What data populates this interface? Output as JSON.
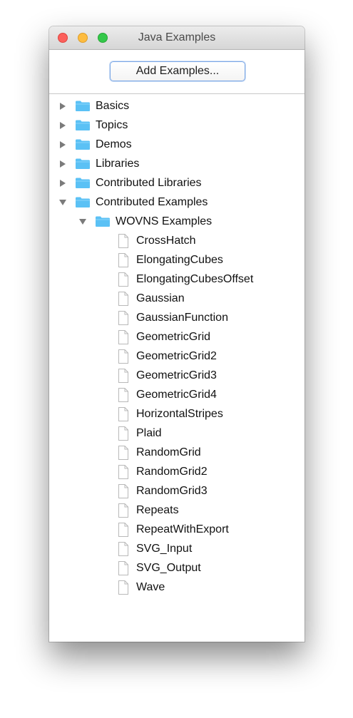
{
  "window": {
    "title": "Java Examples"
  },
  "toolbar": {
    "add_label": "Add Examples..."
  },
  "tree": {
    "top_folders": [
      {
        "label": "Basics",
        "expanded": false
      },
      {
        "label": "Topics",
        "expanded": false
      },
      {
        "label": "Demos",
        "expanded": false
      },
      {
        "label": "Libraries",
        "expanded": false
      },
      {
        "label": "Contributed Libraries",
        "expanded": false
      },
      {
        "label": "Contributed Examples",
        "expanded": true
      }
    ],
    "subfolder": {
      "label": "WOVNS Examples",
      "expanded": true
    },
    "files": [
      "CrossHatch",
      "ElongatingCubes",
      "ElongatingCubesOffset",
      "Gaussian",
      "GaussianFunction",
      "GeometricGrid",
      "GeometricGrid2",
      "GeometricGrid3",
      "GeometricGrid4",
      "HorizontalStripes",
      "Plaid",
      "RandomGrid",
      "RandomGrid2",
      "RandomGrid3",
      "Repeats",
      "RepeatWithExport",
      "SVG_Input",
      "SVG_Output",
      "Wave"
    ]
  },
  "colors": {
    "folder": "#5bc1f5",
    "close": "#fc605c",
    "minimize": "#fdbc40",
    "maximize": "#34c84a"
  }
}
